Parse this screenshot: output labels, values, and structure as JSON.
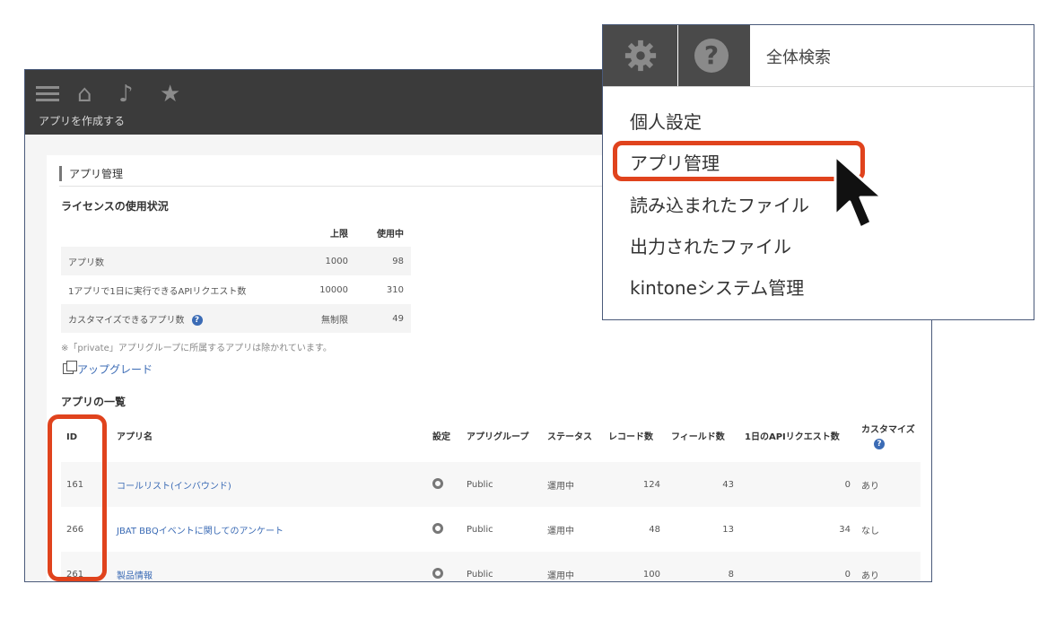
{
  "topbar": {
    "create_app": "アプリを作成する"
  },
  "admin": {
    "title": "アプリ管理",
    "license_heading": "ライセンスの使用状況",
    "license_table": {
      "headers": [
        "上限",
        "使用中"
      ],
      "rows": [
        {
          "label": "アプリ数",
          "limit": "1000",
          "used": "98"
        },
        {
          "label": "1アプリで1日に実行できるAPIリクエスト数",
          "limit": "10000",
          "used": "310"
        },
        {
          "label": "カスタマイズできるアプリ数",
          "limit": "無制限",
          "used": "49"
        }
      ]
    },
    "note": "※「private」アプリグループに所属するアプリは除かれています。",
    "upgrade": "アップグレード",
    "apps_heading": "アプリの一覧",
    "apps_table": {
      "headers": [
        "ID",
        "アプリ名",
        "設定",
        "アプリグループ",
        "ステータス",
        "レコード数",
        "フィールド数",
        "1日のAPIリクエスト数",
        "カスタマイズ"
      ],
      "rows": [
        {
          "id": "161",
          "name": "コールリスト(インバウンド)",
          "group": "Public",
          "status": "運用中",
          "records": "124",
          "fields": "43",
          "api": "0",
          "custom": "あり"
        },
        {
          "id": "266",
          "name": "JBAT BBQイベントに関してのアンケート",
          "group": "Public",
          "status": "運用中",
          "records": "48",
          "fields": "13",
          "api": "34",
          "custom": "なし"
        },
        {
          "id": "261",
          "name": "製品情報",
          "group": "Public",
          "status": "運用中",
          "records": "100",
          "fields": "8",
          "api": "0",
          "custom": "あり"
        }
      ]
    }
  },
  "dropdown": {
    "search": "全体検索",
    "items": [
      "個人設定",
      "アプリ管理",
      "読み込まれたファイル",
      "出力されたファイル",
      "kintoneシステム管理"
    ]
  },
  "colors": {
    "highlight": "#e0431d",
    "topbar": "#3b3b3b",
    "link": "#3b6bb5"
  }
}
